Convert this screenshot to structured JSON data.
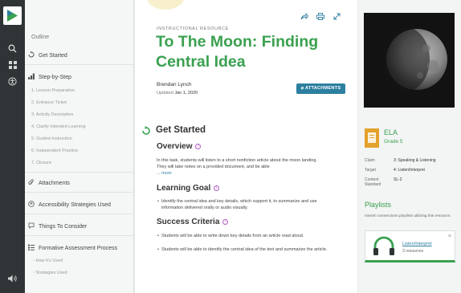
{
  "outline": {
    "title": "Outline",
    "items": [
      {
        "label": "Get Started"
      },
      {
        "label": "Step-by-Step"
      },
      {
        "label": "Attachments"
      },
      {
        "label": "Accessibility Strategies Used"
      },
      {
        "label": "Things To Consider"
      },
      {
        "label": "Formative Assessment Process"
      }
    ],
    "steps": [
      "1. Lesson Preparation",
      "2. Entrance Ticket",
      "3. Activity Description",
      "4. Clarify Intended Learning",
      "5. Guided Instruction",
      "6. Independent Practice",
      "7. Closure"
    ],
    "fap_subs": [
      "How It's Used",
      "Strategies Used"
    ]
  },
  "resource": {
    "label": "INSTRUCTIONAL RESOURCE",
    "title": "To The Moon: Finding Central Idea",
    "author": "Brendan Lynch",
    "updated_prefix": "Updated",
    "updated_date": "Jan 1, 2020",
    "attachments_label": "ATTACHMENTS"
  },
  "content": {
    "get_started": "Get Started",
    "overview_heading": "Overview",
    "overview_text": "In this task, students will listen to a short nonfiction article about the moon landing. They will take notes on a provided document, and be able",
    "more_label": "... more",
    "learning_goal_heading": "Learning Goal",
    "learning_goal_bullet": "Identify the central idea and key details, which support it, to summarize and use information delivered orally or audio visually.",
    "success_heading": "Success Criteria",
    "success_bullets": [
      "Students will be able to write down key details from an article read aloud.",
      "Students will be able to identify the central idea of the text and summarize the article."
    ]
  },
  "sidebar": {
    "subject": "ELA",
    "grade": "Grade 5",
    "meta": [
      {
        "key": "Claim",
        "value": "3: Speaking & Listening"
      },
      {
        "key": "Target",
        "value": "4: Listen/Interpret"
      },
      {
        "key": "Content Standard",
        "value": "SL-2"
      }
    ],
    "playlists_heading": "Playlists",
    "playlists_desc": "Interim connections playlists utilizing this resource.",
    "playlist_name": "Listen/Interpret",
    "playlist_count": "3 resources"
  },
  "colors": {
    "accent_green": "#3aa150",
    "accent_blue": "#2d7fa0",
    "rail": "#2f3436",
    "ela_badge": "#e3a22c"
  }
}
